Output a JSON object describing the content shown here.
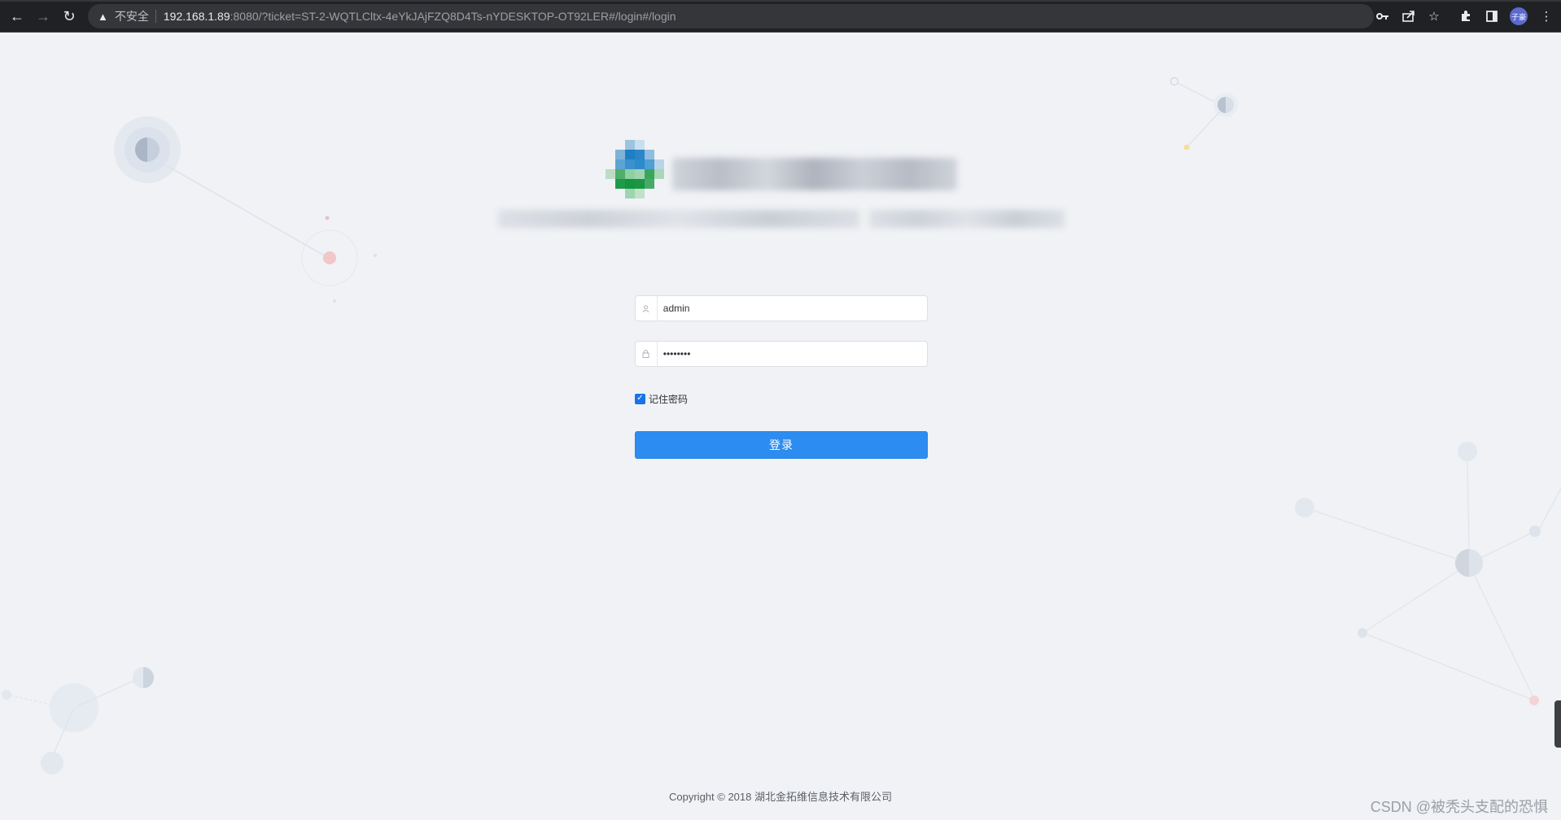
{
  "browser": {
    "security_warning": "不安全",
    "url_host": "192.168.1.89",
    "url_rest": ":8080/?ticket=ST-2-WQTLCltx-4eYkJAjFZQ8D4Ts-nYDESKTOP-OT92LER#/login#/login",
    "profile_label": "子豪"
  },
  "login": {
    "username_value": "admin",
    "password_value": "••••••••",
    "remember_label": "记住密码",
    "remember_checked": true,
    "submit_label": "登录"
  },
  "footer": {
    "copyright": "Copyright © 2018 湖北金拓维信息技术有限公司"
  },
  "watermark": "CSDN @被秃头支配的恐惧",
  "colors": {
    "primary": "#2d8cf0",
    "background": "#f0f2f5",
    "chrome": "#202124"
  }
}
